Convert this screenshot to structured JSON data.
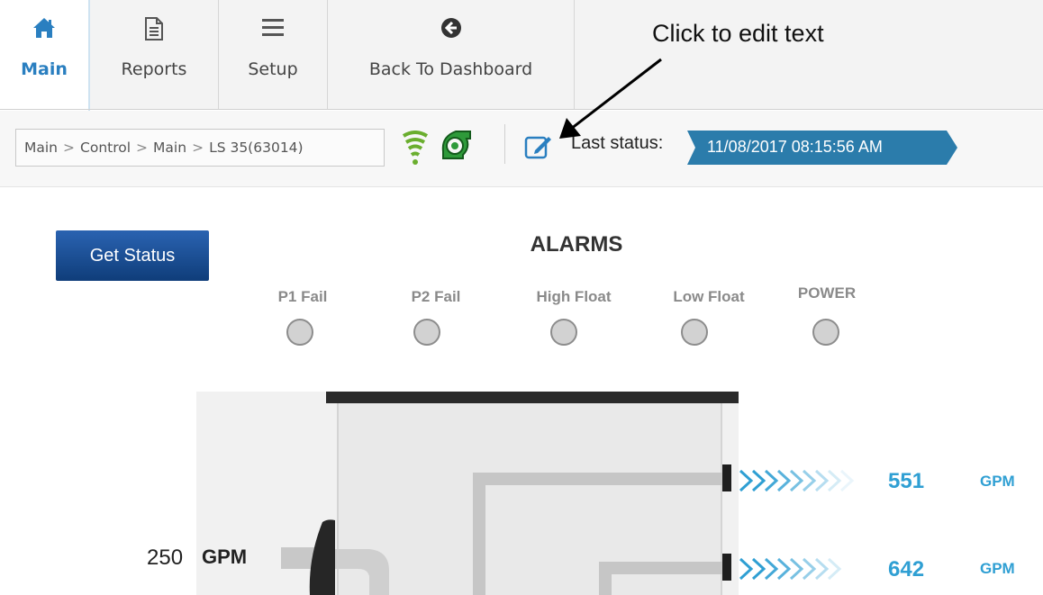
{
  "nav": {
    "tabs": [
      {
        "label": "Main",
        "icon": "home-icon",
        "active": true
      },
      {
        "label": "Reports",
        "icon": "document-icon"
      },
      {
        "label": "Setup",
        "icon": "menu-icon"
      },
      {
        "label": "Back To Dashboard",
        "icon": "back-arrow-icon"
      }
    ]
  },
  "annotation": {
    "text": "Click to edit text"
  },
  "breadcrumb": {
    "items": [
      "Main",
      "Control",
      "Main",
      "LS 35(63014)"
    ],
    "separator": ">"
  },
  "status": {
    "last_status_label": "Last status:",
    "timestamp": "11/08/2017 08:15:56 AM",
    "icons": [
      "signal-icon",
      "pump-icon",
      "edit-icon"
    ]
  },
  "controls": {
    "get_status_label": "Get Status"
  },
  "alarms": {
    "title": "ALARMS",
    "items": [
      {
        "label": "P1 Fail"
      },
      {
        "label": "P2 Fail"
      },
      {
        "label": "High Float"
      },
      {
        "label": "Low Float"
      },
      {
        "label": "POWER"
      }
    ]
  },
  "station": {
    "inflow": {
      "value": "250",
      "unit": "GPM"
    },
    "outflows": [
      {
        "value": "551",
        "unit": "GPM"
      },
      {
        "value": "642",
        "unit": "GPM"
      }
    ]
  },
  "colors": {
    "accent": "#2a7fc0",
    "flow": "#2f9fd3",
    "status_badge": "#2b7cab",
    "signal": "#6aae2e",
    "pump": "#2e9a3a",
    "button": "#1c4f97"
  }
}
